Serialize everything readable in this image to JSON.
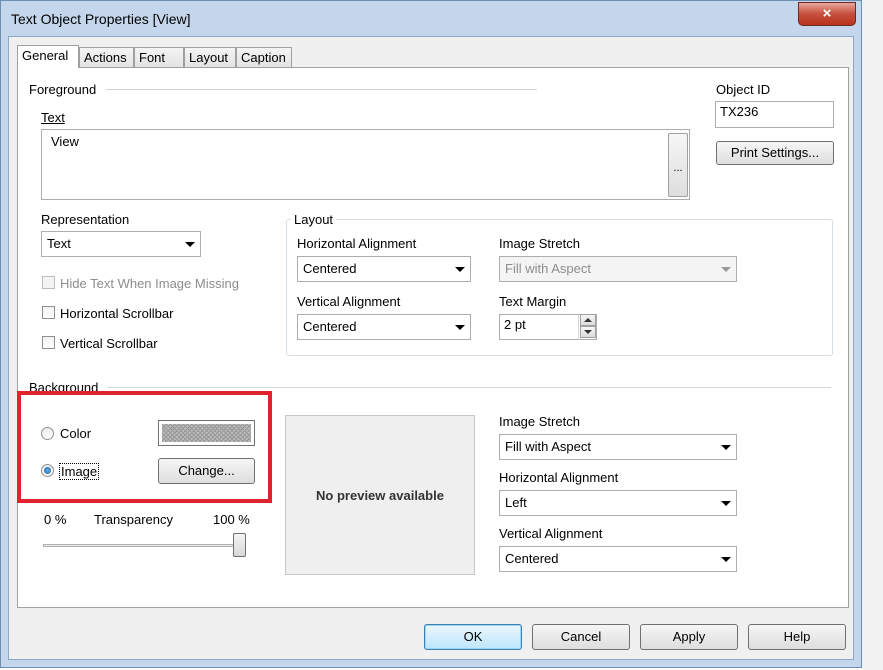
{
  "window": {
    "title": "Text Object Properties [View]",
    "close_glyph": "×"
  },
  "tabs": [
    {
      "label": "General"
    },
    {
      "label": "Actions"
    },
    {
      "label": "Font"
    },
    {
      "label": "Layout"
    },
    {
      "label": "Caption"
    }
  ],
  "foreground": {
    "section_label": "Foreground",
    "text_label": "Text",
    "text_value": "View",
    "ellipsis": "..."
  },
  "object_id": {
    "label": "Object ID",
    "value": "TX236",
    "print_settings": "Print Settings..."
  },
  "representation": {
    "label": "Representation",
    "value": "Text"
  },
  "checkboxes": {
    "hide_text": "Hide Text When Image Missing",
    "horizontal_scrollbar": "Horizontal Scrollbar",
    "vertical_scrollbar": "Vertical Scrollbar"
  },
  "layout_group": {
    "title": "Layout",
    "h_align_label": "Horizontal Alignment",
    "h_align_value": "Centered",
    "v_align_label": "Vertical Alignment",
    "v_align_value": "Centered",
    "image_stretch_label": "Image Stretch",
    "image_stretch_value": "Fill with Aspect",
    "text_margin_label": "Text Margin",
    "text_margin_value": "2 pt"
  },
  "background": {
    "section_label": "Background",
    "color_label": "Color",
    "image_label": "Image",
    "change_button": "Change...",
    "selected": "image",
    "transparency_min": "0 %",
    "transparency_label": "Transparency",
    "transparency_max": "100 %",
    "transparency_value": 1.0,
    "preview_text": "No preview available",
    "image_stretch_label": "Image Stretch",
    "image_stretch_value": "Fill with Aspect",
    "h_align_label": "Horizontal Alignment",
    "h_align_value": "Left",
    "v_align_label": "Vertical Alignment",
    "v_align_value": "Centered"
  },
  "footer": {
    "ok": "OK",
    "cancel": "Cancel",
    "apply": "Apply",
    "help": "Help"
  },
  "colors": {
    "highlight": "#e0232c",
    "window_frame": "#c4d6ec"
  }
}
